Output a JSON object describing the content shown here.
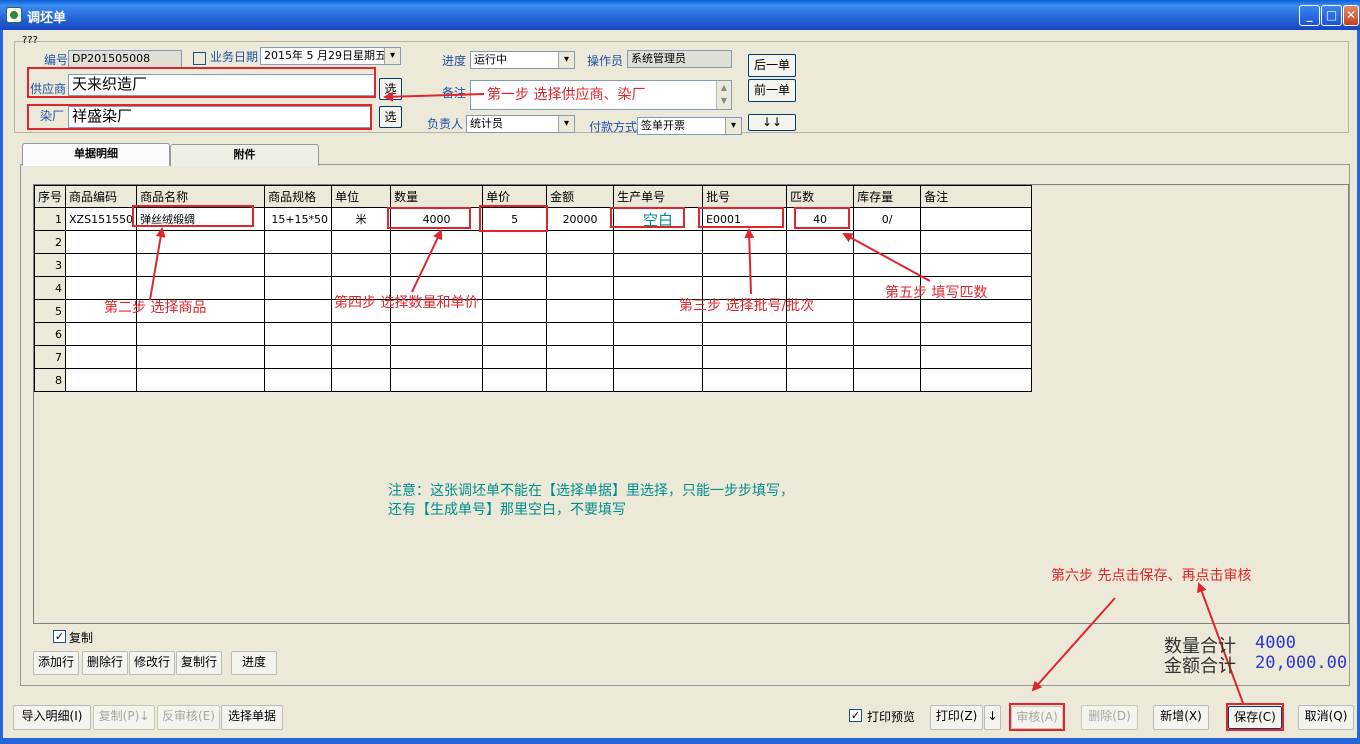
{
  "window": {
    "title": "调坯单",
    "min": "_",
    "max": "□",
    "close": "✕"
  },
  "header": {
    "group_title": "???",
    "code_label": "编号",
    "code_value": "DP201505008",
    "date_label": "业务日期",
    "date_value": "2015年 5 月29日星期五",
    "progress_label": "进度",
    "progress_value": "运行中",
    "operator_label": "操作员",
    "operator_value": "系统管理员",
    "supplier_label": "供应商",
    "supplier_value": "天来织造厂",
    "dyer_label": "染厂",
    "dyer_value": "祥盛染厂",
    "select_label": "选",
    "remark_label": "备注",
    "owner_label": "负责人",
    "owner_value": "统计员",
    "payment_label": "付款方式",
    "payment_value": "签单开票",
    "next_label": "后一单",
    "prev_label": "前一单",
    "arrows_label": "↓↓"
  },
  "tabs": [
    "单据明细",
    "附件"
  ],
  "grid": {
    "columns": [
      "序号",
      "商品编码",
      "商品名称",
      "商品规格",
      "单位",
      "数量",
      "单价",
      "金额",
      "生产单号",
      "批号",
      "匹数",
      "库存量",
      "备注"
    ],
    "rows": [
      [
        "1",
        "XZS151550",
        "弹丝绒缎绸",
        "15+15*50",
        "米",
        "4000",
        "5",
        "20000",
        "空白",
        "E0001",
        "40",
        "0/",
        ""
      ],
      [
        "2",
        "",
        "",
        "",
        "",
        "",
        "",
        "",
        "",
        "",
        "",
        "",
        ""
      ],
      [
        "3",
        "",
        "",
        "",
        "",
        "",
        "",
        "",
        "",
        "",
        "",
        "",
        ""
      ],
      [
        "4",
        "",
        "",
        "",
        "",
        "",
        "",
        "",
        "",
        "",
        "",
        "",
        ""
      ],
      [
        "5",
        "",
        "",
        "",
        "",
        "",
        "",
        "",
        "",
        "",
        "",
        "",
        ""
      ],
      [
        "6",
        "",
        "",
        "",
        "",
        "",
        "",
        "",
        "",
        "",
        "",
        "",
        ""
      ],
      [
        "7",
        "",
        "",
        "",
        "",
        "",
        "",
        "",
        "",
        "",
        "",
        "",
        ""
      ],
      [
        "8",
        "",
        "",
        "",
        "",
        "",
        "",
        "",
        "",
        "",
        "",
        "",
        ""
      ]
    ]
  },
  "annotations": {
    "step1": "第一步 选择供应商、染厂",
    "step2": "第二步 选择商品",
    "step3": "第三步 选择批号/批次",
    "step4": "第四步 选择数量和单价",
    "step5": "第五步 填写匹数",
    "step6": "第六步 先点击保存、再点击审核",
    "note1": "注意：这张调坯单不能在【选择单据】里选择，只能一步步填写，",
    "note2": "还有【生成单号】那里空白，不要填写"
  },
  "grid_tools": {
    "copy_check": "✓",
    "copy_label": "复制",
    "add": "添加行",
    "delete": "删除行",
    "modify": "修改行",
    "copy": "复制行",
    "progress": "进度"
  },
  "totals": {
    "qty_label": "数量合计",
    "qty_value": "4000",
    "amount_label": "金额合计",
    "amount_value": "20,000.00"
  },
  "footer": {
    "import": "导入明细(I)",
    "copy": "复制(P)↓",
    "unaudit": "反审核(E)",
    "select": "选择单据",
    "preview_check": "✓",
    "preview_label": "打印预览",
    "print": "打印(Z)",
    "print_arrow": "↓",
    "audit": "审核(A)",
    "delete": "删除(D)",
    "new": "新增(X)",
    "save": "保存(C)",
    "cancel": "取消(Q)"
  },
  "colors": {
    "annotation": "#e0262d",
    "note": "#008f8f",
    "titlebar": "#2566d8",
    "totals": "#2a39d4"
  }
}
